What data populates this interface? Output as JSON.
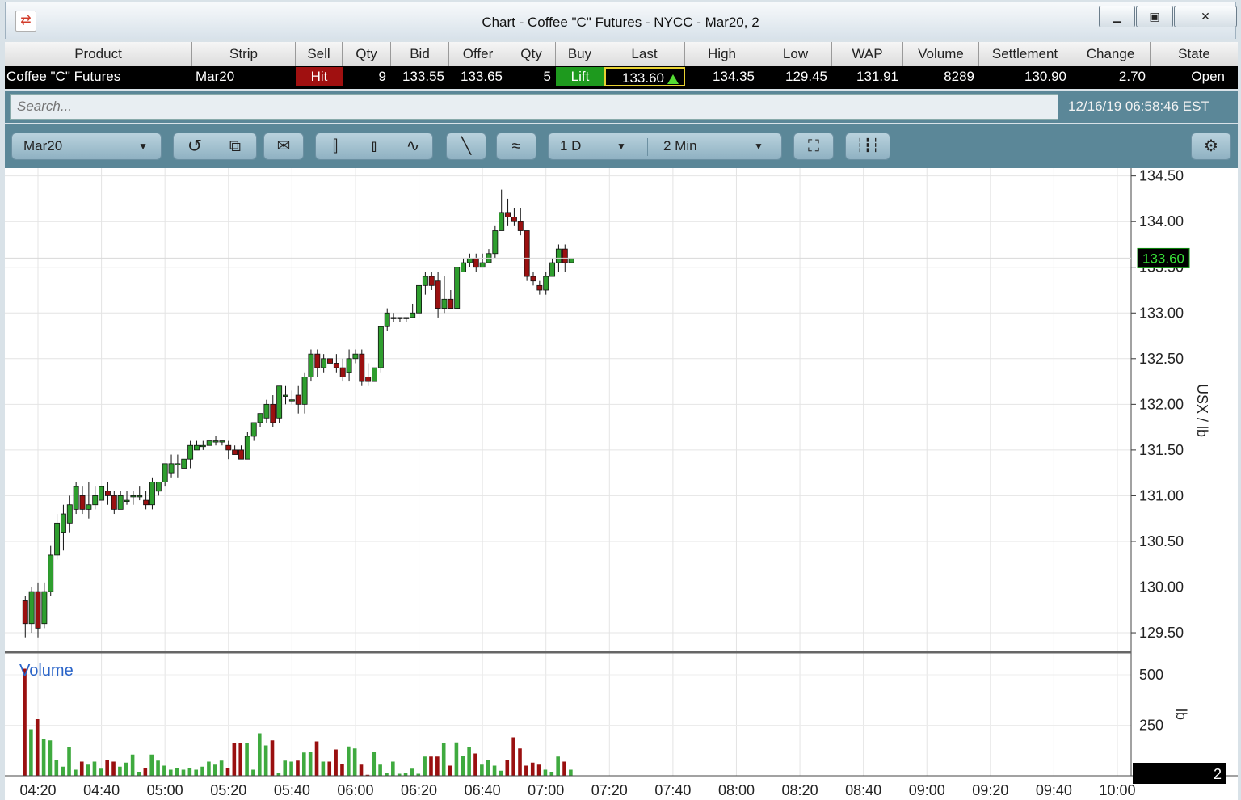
{
  "window": {
    "title": "Chart - Coffee \"C\" Futures - NYCC - Mar20, 2",
    "app_icon": "exchange-arrows-icon",
    "buttons": [
      "minimize-icon",
      "maximize-icon",
      "close-icon"
    ]
  },
  "quote": {
    "headers": [
      "Product",
      "Strip",
      "Sell",
      "Qty",
      "Bid",
      "Offer",
      "Qty",
      "Buy",
      "Last",
      "High",
      "Low",
      "WAP",
      "Volume",
      "Settlement",
      "Change",
      "State"
    ],
    "row": {
      "product": "Coffee \"C\" Futures",
      "strip": "Mar20",
      "sell": "Hit",
      "bid_qty": "9",
      "bid": "133.55",
      "offer": "133.65",
      "offer_qty": "5",
      "buy": "Lift",
      "last": "133.60",
      "high": "134.35",
      "low": "129.45",
      "wap": "131.91",
      "volume": "8289",
      "settlement": "130.90",
      "change": "2.70",
      "state": "Open"
    },
    "colors": {
      "hit": "#a01010",
      "lift": "#1e9a1e",
      "last_border": "#e8d232",
      "up_arrow": "#55dd33"
    }
  },
  "search": {
    "placeholder": "Search...",
    "timestamp": "12/16/19 06:58:46 EST"
  },
  "toolbar": {
    "strip_select": "Mar20",
    "period_select": "1 D",
    "interval_select": "2 Min",
    "icons": [
      "refresh-icon",
      "popout-icon",
      "snapshot-icon",
      "candlestick-icon",
      "ohlc-bar-icon",
      "line-chart-icon",
      "draw-line-icon",
      "study-icon",
      "fullscreen-icon",
      "volume-toggle-icon",
      "settings-gear-icon"
    ]
  },
  "chart_data": {
    "type": "candlestick",
    "price_axis_label": "USX / lb",
    "volume_axis_label": "lb",
    "volume_label": "Volume",
    "price_ticks": [
      "134.50",
      "134.00",
      "133.50",
      "133.00",
      "132.50",
      "132.00",
      "131.50",
      "131.00",
      "130.50",
      "130.00",
      "129.50"
    ],
    "price_range": [
      129.35,
      134.55
    ],
    "last_price": "133.60",
    "last_price_color": "#0a8a0a",
    "volume_ticks": [
      "500",
      "250"
    ],
    "volume_range": [
      0,
      560
    ],
    "last_volume": "2",
    "time_ticks": [
      "04:20",
      "04:40",
      "05:00",
      "05:20",
      "05:40",
      "06:00",
      "06:20",
      "06:40",
      "07:00",
      "07:20",
      "07:40",
      "08:00",
      "08:20",
      "08:40",
      "09:00",
      "09:20",
      "09:40",
      "10:00"
    ],
    "time_range_minutes": [
      255,
      610
    ],
    "bar_interval_minutes": 2,
    "start_time": "04:16",
    "up_color": "#2e9e2e",
    "down_color": "#9a1010",
    "bars": [
      [
        129.85,
        129.6,
        129.9,
        129.45
      ],
      [
        129.6,
        129.95,
        130.0,
        129.5
      ],
      [
        129.95,
        129.55,
        130.05,
        129.45
      ],
      [
        129.6,
        129.95,
        130.05,
        129.55
      ],
      [
        129.95,
        130.35,
        130.45,
        129.9
      ],
      [
        130.35,
        130.7,
        130.8,
        130.3
      ],
      [
        130.6,
        130.8,
        130.9,
        130.4
      ],
      [
        130.7,
        130.9,
        131.0,
        130.6
      ],
      [
        130.85,
        131.1,
        131.15,
        130.8
      ],
      [
        131.0,
        130.85,
        131.1,
        130.8
      ],
      [
        130.85,
        130.9,
        131.15,
        130.75
      ],
      [
        130.9,
        131.0,
        131.1,
        130.85
      ],
      [
        130.95,
        131.1,
        131.1,
        130.95
      ],
      [
        131.05,
        131.0,
        131.15,
        130.9
      ],
      [
        131.0,
        130.85,
        131.05,
        130.8
      ],
      [
        130.85,
        131.0,
        131.05,
        130.85
      ],
      [
        130.95,
        130.95,
        131.05,
        130.9
      ],
      [
        131.0,
        131.0,
        131.05,
        130.9
      ],
      [
        131.0,
        131.0,
        131.1,
        130.95
      ],
      [
        130.95,
        130.9,
        131.05,
        130.85
      ],
      [
        130.9,
        131.15,
        131.2,
        130.85
      ],
      [
        131.05,
        131.15,
        131.15,
        131.0
      ],
      [
        131.15,
        131.35,
        131.35,
        131.1
      ],
      [
        131.25,
        131.35,
        131.45,
        131.2
      ],
      [
        131.35,
        131.35,
        131.45,
        131.2
      ],
      [
        131.3,
        131.4,
        131.4,
        131.3
      ],
      [
        131.4,
        131.55,
        131.6,
        131.3
      ],
      [
        131.5,
        131.55,
        131.6,
        131.5
      ],
      [
        131.55,
        131.55,
        131.6,
        131.5
      ],
      [
        131.55,
        131.6,
        131.6,
        131.55
      ],
      [
        131.6,
        131.6,
        131.65,
        131.55
      ],
      [
        131.6,
        131.6,
        131.6,
        131.55
      ],
      [
        131.55,
        131.5,
        131.6,
        131.4
      ],
      [
        131.5,
        131.45,
        131.55,
        131.45
      ],
      [
        131.5,
        131.4,
        131.55,
        131.4
      ],
      [
        131.4,
        131.65,
        131.7,
        131.4
      ],
      [
        131.65,
        131.8,
        131.8,
        131.6
      ],
      [
        131.8,
        131.9,
        131.9,
        131.75
      ],
      [
        131.85,
        132.0,
        132.05,
        131.8
      ],
      [
        132.0,
        131.8,
        132.1,
        131.75
      ],
      [
        131.85,
        132.2,
        132.2,
        131.8
      ],
      [
        132.1,
        132.1,
        132.2,
        132.0
      ],
      [
        132.05,
        132.05,
        132.15,
        132.0
      ],
      [
        132.1,
        132.0,
        132.2,
        131.9
      ],
      [
        132.0,
        132.3,
        132.35,
        131.9
      ],
      [
        132.3,
        132.55,
        132.6,
        132.25
      ],
      [
        132.55,
        132.4,
        132.6,
        132.3
      ],
      [
        132.4,
        132.5,
        132.55,
        132.35
      ],
      [
        132.5,
        132.45,
        132.55,
        132.4
      ],
      [
        132.45,
        132.4,
        132.55,
        132.35
      ],
      [
        132.4,
        132.3,
        132.5,
        132.25
      ],
      [
        132.35,
        132.5,
        132.6,
        132.25
      ],
      [
        132.5,
        132.55,
        132.6,
        132.45
      ],
      [
        132.55,
        132.25,
        132.6,
        132.2
      ],
      [
        132.3,
        132.25,
        132.45,
        132.2
      ],
      [
        132.25,
        132.4,
        132.4,
        132.25
      ],
      [
        132.4,
        132.85,
        132.85,
        132.35
      ],
      [
        132.85,
        133.0,
        133.05,
        132.8
      ],
      [
        132.95,
        132.95,
        133.0,
        132.9
      ],
      [
        132.95,
        132.95,
        132.95,
        132.9
      ],
      [
        132.95,
        132.95,
        132.95,
        132.9
      ],
      [
        132.95,
        133.0,
        133.1,
        132.95
      ],
      [
        133.0,
        133.3,
        133.3,
        132.95
      ],
      [
        133.3,
        133.4,
        133.45,
        133.2
      ],
      [
        133.4,
        133.3,
        133.45,
        133.25
      ],
      [
        133.35,
        133.05,
        133.45,
        132.95
      ],
      [
        133.05,
        133.15,
        133.4,
        133.0
      ],
      [
        133.15,
        133.05,
        133.25,
        133.05
      ],
      [
        133.05,
        133.5,
        133.5,
        133.05
      ],
      [
        133.45,
        133.55,
        133.6,
        133.45
      ],
      [
        133.55,
        133.6,
        133.65,
        133.5
      ],
      [
        133.6,
        133.5,
        133.65,
        133.45
      ],
      [
        133.5,
        133.55,
        133.65,
        133.5
      ],
      [
        133.55,
        133.65,
        133.7,
        133.55
      ],
      [
        133.65,
        133.9,
        133.95,
        133.6
      ],
      [
        133.9,
        134.1,
        134.35,
        133.9
      ],
      [
        134.1,
        134.05,
        134.25,
        133.95
      ],
      [
        134.05,
        134.0,
        134.15,
        133.95
      ],
      [
        134.0,
        133.9,
        134.15,
        133.85
      ],
      [
        133.9,
        133.4,
        133.9,
        133.35
      ],
      [
        133.4,
        133.35,
        133.45,
        133.3
      ],
      [
        133.3,
        133.25,
        133.35,
        133.2
      ],
      [
        133.25,
        133.4,
        133.45,
        133.2
      ],
      [
        133.4,
        133.55,
        133.6,
        133.4
      ],
      [
        133.55,
        133.7,
        133.75,
        133.45
      ],
      [
        133.7,
        133.55,
        133.75,
        133.45
      ],
      [
        133.55,
        133.6,
        133.6,
        133.55
      ]
    ],
    "volumes": [
      530,
      230,
      280,
      180,
      175,
      80,
      45,
      140,
      30,
      70,
      55,
      70,
      35,
      80,
      70,
      45,
      65,
      105,
      20,
      40,
      105,
      75,
      50,
      30,
      40,
      30,
      40,
      30,
      45,
      70,
      55,
      75,
      40,
      160,
      160,
      160,
      30,
      210,
      150,
      175,
      15,
      75,
      70,
      75,
      115,
      120,
      170,
      70,
      70,
      130,
      60,
      145,
      135,
      55,
      5,
      120,
      55,
      15,
      70,
      10,
      15,
      35,
      10,
      95,
      95,
      95,
      160,
      50,
      165,
      100,
      140,
      110,
      55,
      80,
      50,
      25,
      80,
      190,
      135,
      50,
      65,
      55,
      30,
      20,
      95,
      70,
      30
    ]
  }
}
